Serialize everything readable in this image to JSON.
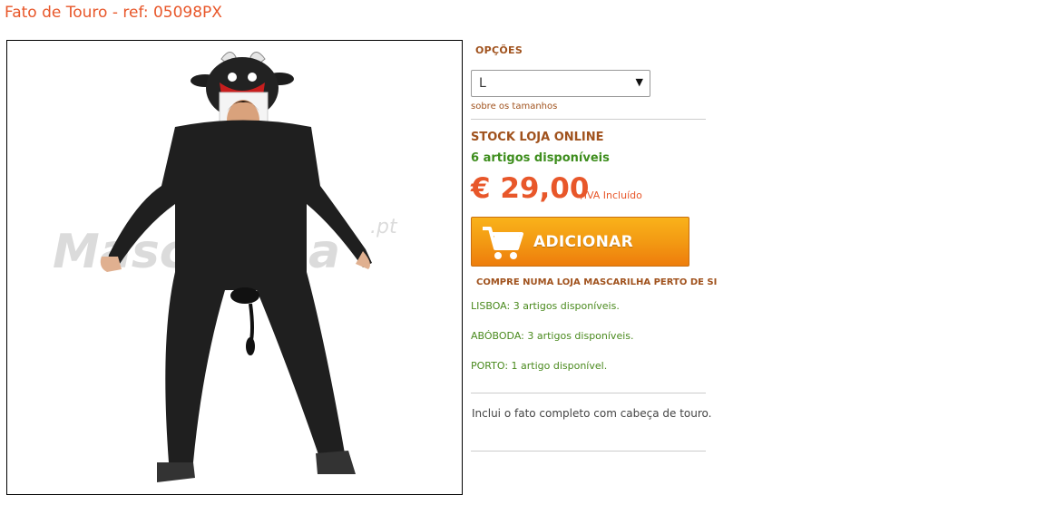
{
  "product": {
    "title": "Fato de Touro - ref: 05098PX",
    "image_watermark": "Mascarilha.pt"
  },
  "options": {
    "label": "OPÇÕES",
    "size_selected": "L",
    "size_link": "sobre os tamanhos"
  },
  "stock": {
    "title": "STOCK LOJA ONLINE",
    "available": "6 artigos disponíveis"
  },
  "price": {
    "value": "€ 29,00",
    "vat_note": "/IVA Incluído"
  },
  "add_button": {
    "label": "ADICIONAR",
    "icon": "cart-icon"
  },
  "local_stores": {
    "title": "COMPRE NUMA LOJA MASCARILHA PERTO DE SI",
    "stores": [
      "LISBOA: 3 artigos disponíveis.",
      "ABÓBODA: 3 artigos disponíveis.",
      "PORTO: 1 artigo disponível."
    ]
  },
  "description": "Inclui o fato completo com cabeça de touro.",
  "colors": {
    "title_orange": "#e8572a",
    "label_brown": "#a0521d",
    "stock_green": "#3e8e1e",
    "button_orange": "#f39a13"
  }
}
